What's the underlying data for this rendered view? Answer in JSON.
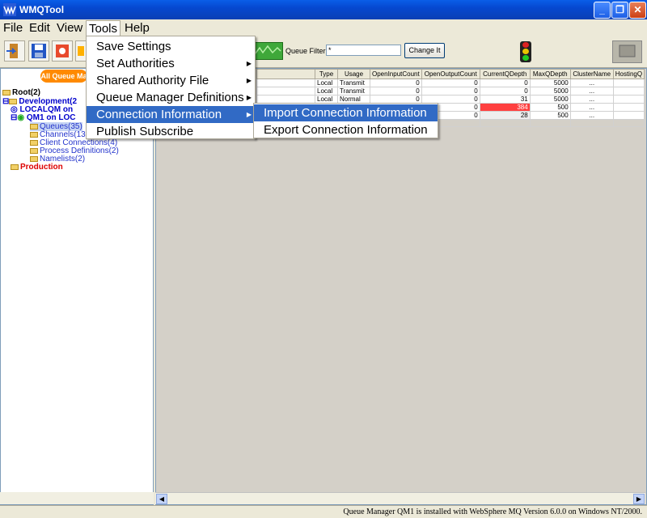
{
  "window": {
    "title": "WMQTool",
    "controls": {
      "minimize": "_",
      "restore": "❐",
      "close": "✕"
    }
  },
  "menubar": {
    "items": [
      "File",
      "Edit",
      "View",
      "Tools",
      "Help"
    ],
    "active": "Tools"
  },
  "tools_menu": {
    "items": [
      {
        "label": "Save Settings",
        "submenu": false
      },
      {
        "label": "Set Authorities",
        "submenu": true
      },
      {
        "label": "Shared Authority File",
        "submenu": true
      },
      {
        "label": "Queue Manager Definitions",
        "submenu": true
      },
      {
        "label": "Connection Information",
        "submenu": true,
        "selected": true
      },
      {
        "label": "Publish Subscribe",
        "submenu": false
      }
    ]
  },
  "connection_submenu": {
    "items": [
      {
        "label": "Import Connection Information",
        "selected": true
      },
      {
        "label": "Export Connection Information",
        "selected": false
      }
    ]
  },
  "toolbar": {
    "icons": [
      "exit-icon",
      "save-icon",
      "authority-icon",
      "edit-icon"
    ],
    "queue_filter_label": "Queue Filter:",
    "queue_filter_value": "*",
    "change_button": "Change It",
    "all_queue_managers_button": "All Queue Ma"
  },
  "tree": {
    "root": "Root(2)",
    "development": "Development(2",
    "localqm": "LOCALQM on",
    "qm1": "QM1 on LOC",
    "queues": "Queues(35)",
    "channels": "Channels(13",
    "client_connections": "Client Connections(4)",
    "process_definitions": "Process Definitions(2)",
    "namelists": "Namelists(2)",
    "production": "Production"
  },
  "table": {
    "columns": [
      "Type",
      "Usage",
      "OpenInputCount",
      "OpenOutputCount",
      "CurrentQDepth",
      "MaxQDepth",
      "ClusterName",
      "HostingQ"
    ],
    "rows": [
      [
        "Local",
        "Transmit",
        "0",
        "0",
        "0",
        "5000",
        "...",
        ""
      ],
      [
        "Local",
        "Transmit",
        "0",
        "0",
        "0",
        "5000",
        "...",
        ""
      ],
      [
        "Local",
        "Normal",
        "0",
        "0",
        "31",
        "5000",
        "...",
        ""
      ],
      [
        "",
        "",
        "",
        "0",
        "384",
        "500",
        "...",
        ""
      ],
      [
        "",
        "",
        "",
        "0",
        "28",
        "500",
        "...",
        ""
      ]
    ],
    "highlight_color": "#ff4040"
  },
  "status": {
    "text": "Queue Manager QM1 is installed with WebSphere MQ Version 6.0.0 on Windows NT/2000."
  }
}
